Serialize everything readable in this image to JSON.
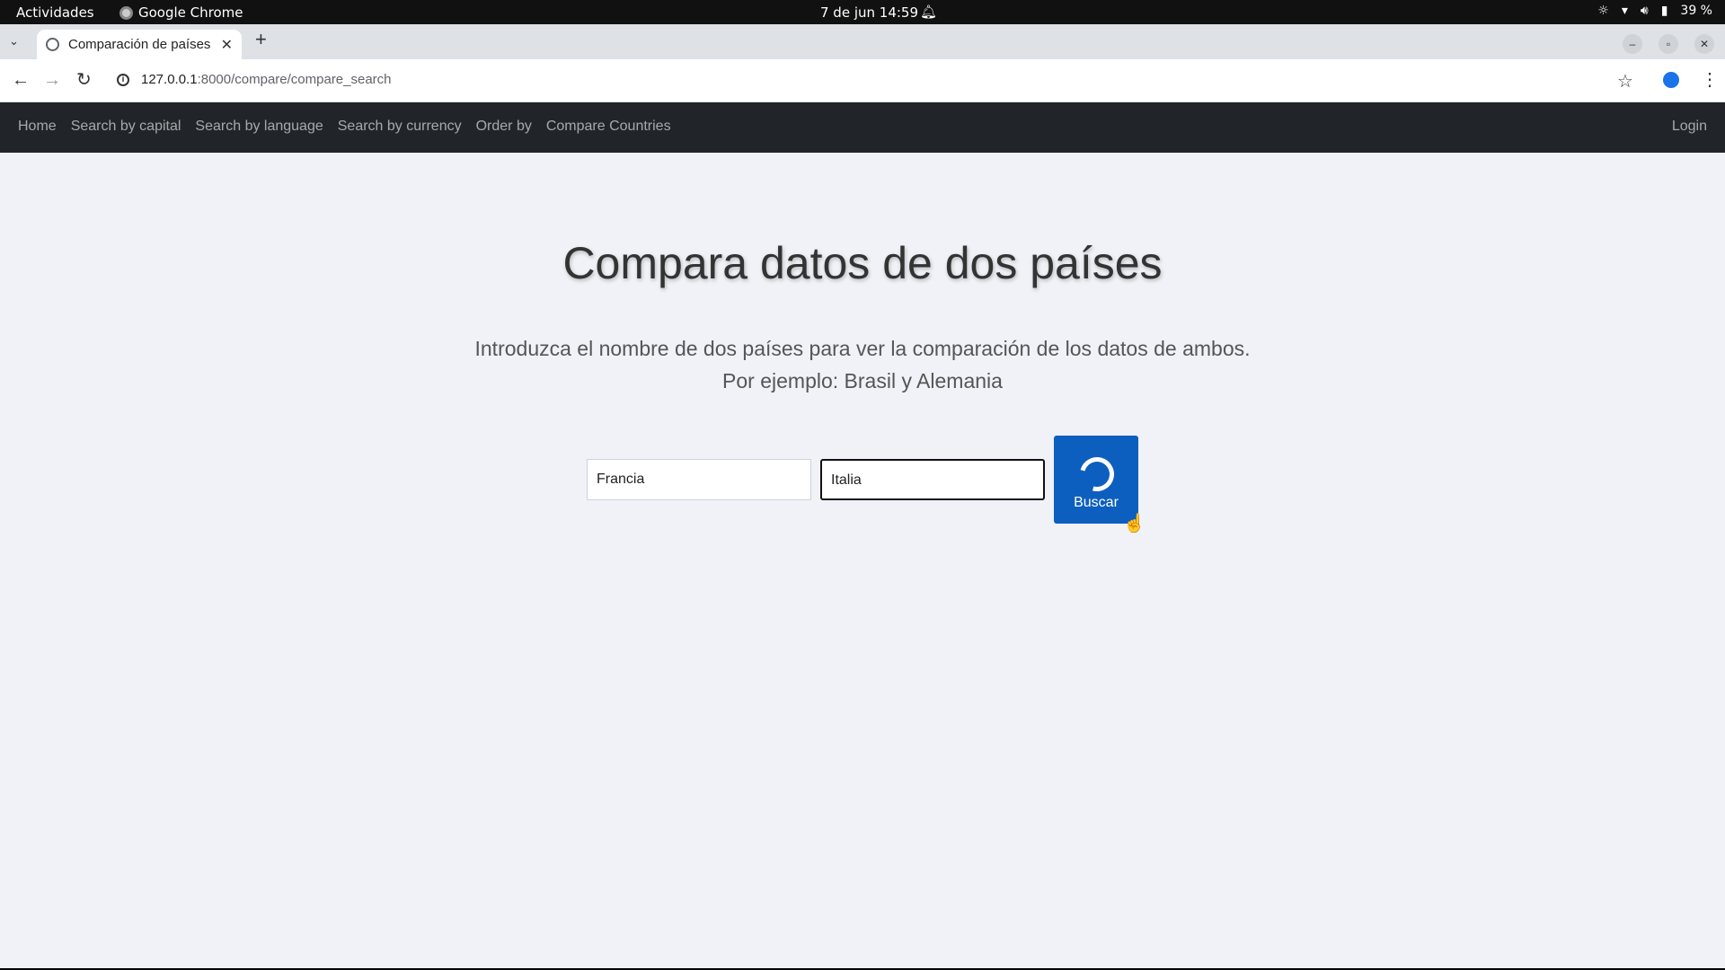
{
  "system": {
    "activities": "Actividades",
    "app_name": "Google Chrome",
    "clock": "7 de jun  14:59",
    "battery": "39 %"
  },
  "browser": {
    "tab_title": "Comparación de países",
    "url_host": "127.0.0.1",
    "url_path": ":8000/compare/compare_search"
  },
  "navbar": {
    "links": [
      "Home",
      "Search by capital",
      "Search by language",
      "Search by currency",
      "Order by",
      "Compare Countries"
    ],
    "login": "Login"
  },
  "main": {
    "title": "Compara datos de dos países",
    "lead_line1": "Introduzca el nombre de dos países para ver la comparación de los datos de ambos.",
    "lead_line2": "Por ejemplo: Brasil y Alemania",
    "country1_value": "Francia",
    "country2_value": "Italia",
    "search_label": "Buscar"
  }
}
